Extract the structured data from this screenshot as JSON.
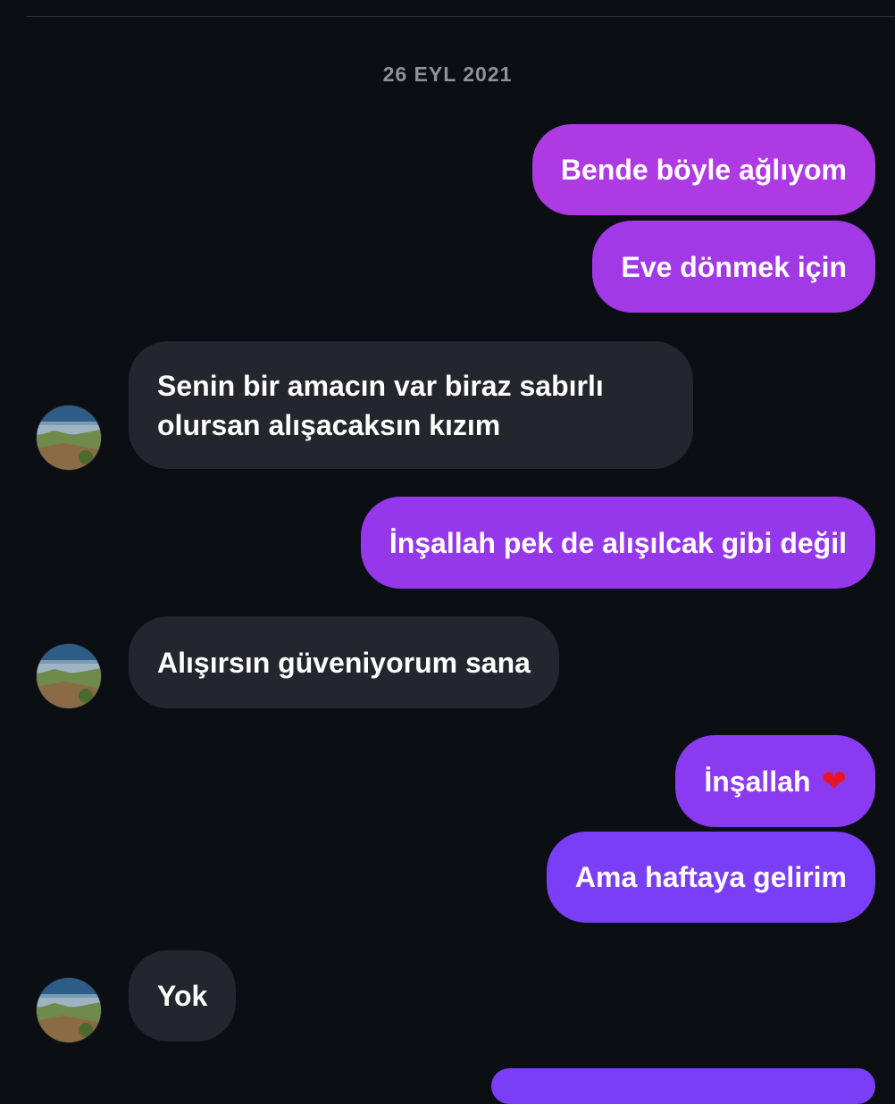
{
  "conversation": {
    "date_label": "26 EYL 2021",
    "messages": [
      {
        "direction": "outgoing",
        "text": "Bende böyle ağlıyom"
      },
      {
        "direction": "outgoing",
        "text": "Eve dönmek için"
      },
      {
        "direction": "incoming",
        "lines": [
          "Senin bir amacın var biraz sabırlı",
          "olursan alışacaksın kızım"
        ]
      },
      {
        "direction": "outgoing",
        "text": "İnşallah pek de alışılcak gibi değil"
      },
      {
        "direction": "incoming",
        "text": "Alışırsın güveniyorum sana"
      },
      {
        "direction": "outgoing",
        "text": "İnşallah",
        "emoji": "❤"
      },
      {
        "direction": "outgoing",
        "text": "Ama haftaya gelirim"
      },
      {
        "direction": "incoming",
        "text": "Yok"
      }
    ]
  },
  "colors": {
    "background": "#0b0e13",
    "incoming_bubble": "#23262c",
    "outgoing_gradient_top": "#b03ae0",
    "outgoing_gradient_bottom": "#7b3ef7"
  },
  "icons": {
    "avatar": "landscape-photo-avatar",
    "heart": "red-heart-emoji"
  }
}
